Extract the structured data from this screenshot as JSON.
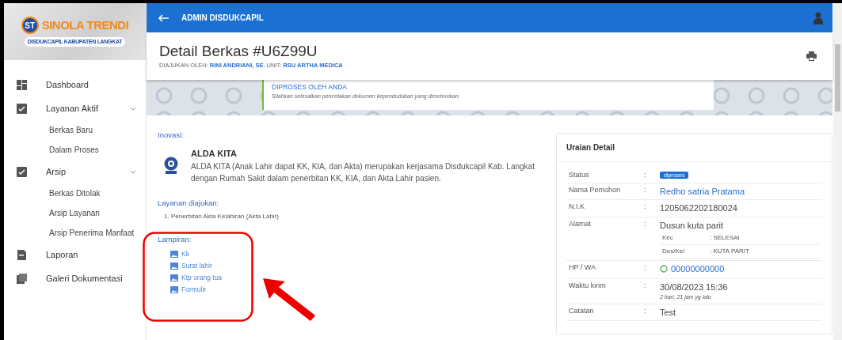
{
  "logo": {
    "title": "SINOLA TRENDI",
    "badge": "ST",
    "subtitle": "DISDUKCAPIL KABUPATEN LANGKAT"
  },
  "sidebar": {
    "items": [
      {
        "label": "Dashboard"
      },
      {
        "label": "Layanan Aktif",
        "expanded": true,
        "children": [
          {
            "label": "Berkas Baru"
          },
          {
            "label": "Dalam Proses"
          }
        ]
      },
      {
        "label": "Arsip",
        "expanded": true,
        "children": [
          {
            "label": "Berkas Ditolak"
          },
          {
            "label": "Arsip Layanan"
          },
          {
            "label": "Arsip Penerima Manfaat"
          }
        ]
      },
      {
        "label": "Laporan"
      },
      {
        "label": "Galeri Dokumentasi"
      }
    ]
  },
  "topbar": {
    "title": "ADMIN DISDUKCAPIL"
  },
  "header": {
    "title": "Detail Berkas #U6Z99U",
    "submitted_by_label": "DIAJUKAN OLEH:",
    "submitted_by": "RINI ANDRIANI, SE.",
    "unit_label": "UNIT:",
    "unit": "RSU ARTHA MEDICA"
  },
  "alert": {
    "title": "DIPROSES OLEH ANDA",
    "text": "Silahkan selesaikan pencetakan dokumen kependudukan yang dimohonkan."
  },
  "inovasi": {
    "label": "Inovasi:",
    "name": "ALDA KITA",
    "description": "ALDA KITA (Anak Lahir dapat KK, KIA, dan Akta) merupakan kerjasama Disdukcapil Kab. Langkat dengan Rumah Sakit dalam penerbitan KK, KIA, dan Akta Lahir pasien."
  },
  "services": {
    "label": "Layanan diajukan:",
    "items": [
      "1. Penerbitan Akta Kelahiran (Akta Lahir)"
    ]
  },
  "attachments": {
    "label": "Lampiran:",
    "items": [
      "Kk",
      "Surat lahir",
      "Ktp orang tua",
      "Formulir"
    ]
  },
  "detail": {
    "title": "Uraian Detail",
    "rows": [
      {
        "label": "Status",
        "sep": ":",
        "kind": "badge",
        "value": "diproses"
      },
      {
        "label": "Nama Pemohon",
        "sep": ":",
        "kind": "link",
        "value": "Redho satria Pratama"
      },
      {
        "label": "N.I.K",
        "sep": ":",
        "kind": "text",
        "value": "1205062202180024"
      },
      {
        "label": "Alamat",
        "sep": ":",
        "kind": "address",
        "value": "Dusun kuta parit",
        "sub": [
          {
            "label": "Kec",
            "value": ": SELESAI"
          },
          {
            "label": "Des/Kel",
            "value": ": KUTA PARIT"
          }
        ]
      },
      {
        "label": "HP / WA",
        "sep": ":",
        "kind": "phone",
        "value": "00000000000"
      },
      {
        "label": "Waktu kirim",
        "sep": ":",
        "kind": "time",
        "value": "30/08/2023 15:36",
        "note": "2 hari, 21 jam yg lalu"
      },
      {
        "label": "Catatan",
        "sep": ":",
        "kind": "text",
        "value": "Test"
      }
    ]
  }
}
